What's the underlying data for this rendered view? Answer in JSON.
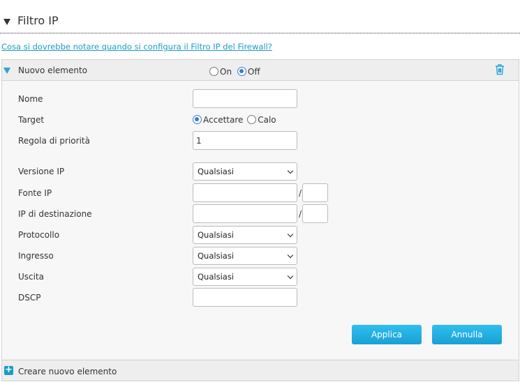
{
  "section": {
    "title": "Filtro IP",
    "help_link": "Cosa si dovrebbe notare quando si configura il Filtro IP del Firewall?"
  },
  "entry": {
    "title": "Nuovo elemento",
    "state_on": "On",
    "state_off": "Off",
    "selected_state": "Off"
  },
  "form": {
    "nome": {
      "label": "Nome",
      "value": ""
    },
    "target": {
      "label": "Target",
      "options": [
        "Accettare",
        "Calo"
      ],
      "selected": "Accettare"
    },
    "priority": {
      "label": "Regola di priorità",
      "value": "1"
    },
    "ip_version": {
      "label": "Versione IP",
      "value": "Qualsiasi"
    },
    "source_ip": {
      "label": "Fonte IP",
      "value": "",
      "mask": "",
      "sep": "/"
    },
    "dest_ip": {
      "label": "IP di destinazione",
      "value": "",
      "mask": "",
      "sep": "/"
    },
    "protocol": {
      "label": "Protocollo",
      "value": "Qualsiasi"
    },
    "ingress": {
      "label": "Ingresso",
      "value": "Qualsiasi"
    },
    "egress": {
      "label": "Uscita",
      "value": "Qualsiasi"
    },
    "dscp": {
      "label": "DSCP",
      "value": ""
    }
  },
  "buttons": {
    "apply": "Applica",
    "cancel": "Annulla"
  },
  "footer": {
    "create": "Creare nuovo elemento"
  }
}
